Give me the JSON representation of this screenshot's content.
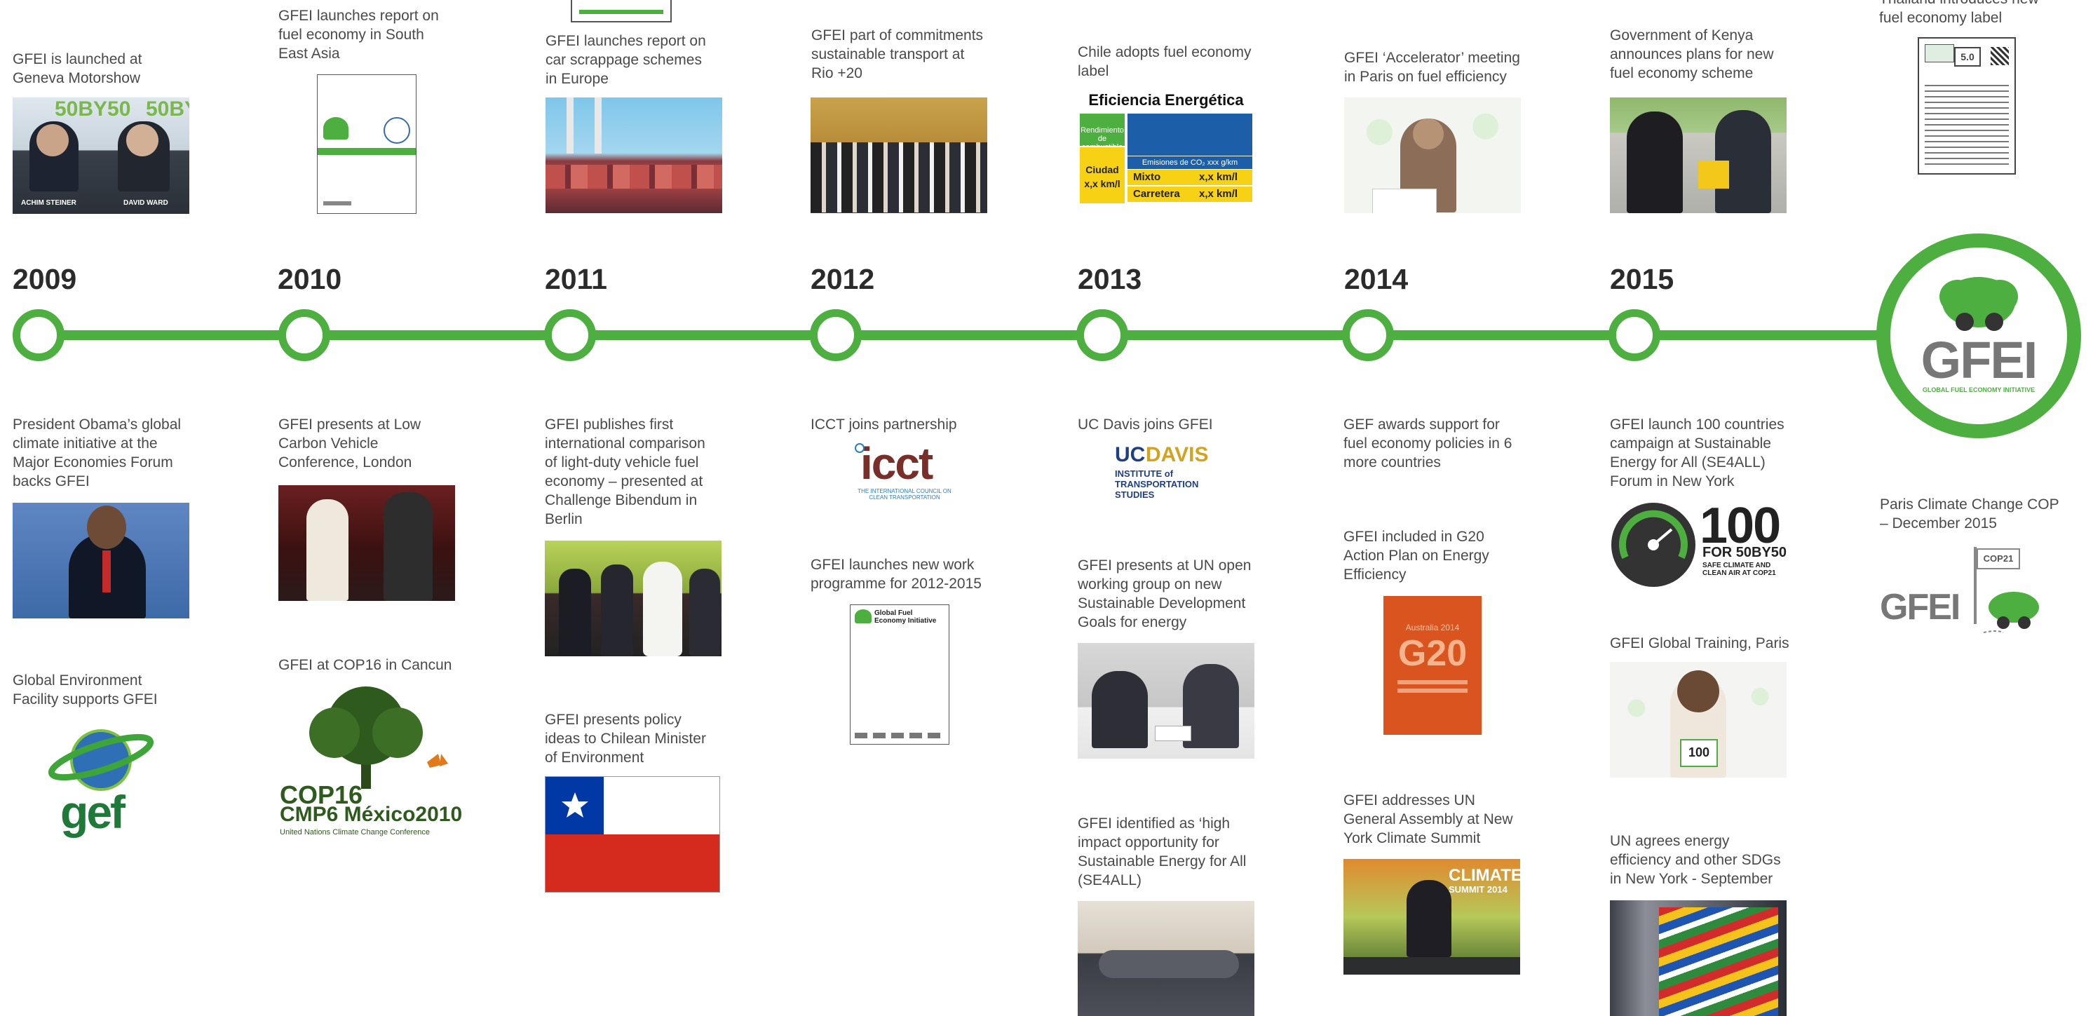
{
  "years": [
    "2009",
    "2010",
    "2011",
    "2012",
    "2013",
    "2014",
    "2015"
  ],
  "top_items": {
    "t2009": "GFEI is launched at Geneva Motorshow",
    "t2010": "GFEI launches report on fuel economy in South East Asia",
    "t2011": "GFEI launches report on car scrappage schemes in Europe",
    "t2012": "GFEI part of commitments sustainable transport at Rio +20",
    "t2013": "Chile adopts fuel economy label",
    "t2014": "GFEI ‘Accelerator’ meeting in Paris on fuel efficiency",
    "t2015": "Government of Kenya announces plans for new fuel economy scheme",
    "t2016": "Thailand introduces new fuel economy label"
  },
  "bottom_items": {
    "b2009a": "President Obama’s global climate initiative at the Major Economies Forum backs GFEI",
    "b2009b": "Global Environment Facility supports GFEI",
    "b2010a": "GFEI presents at Low Carbon Vehicle Conference, London",
    "b2010b": "GFEI at COP16 in Cancun",
    "b2011a": "GFEI publishes first international comparison of light-duty vehicle fuel economy – presented at Challenge Bibendum in Berlin",
    "b2011b": "GFEI presents policy ideas to Chilean Minister of Environment",
    "b2012a": "ICCT joins partnership",
    "b2012b": "GFEI launches new work programme for 2012-2015",
    "b2013a": "UC Davis joins GFEI",
    "b2013b": "GFEI presents at UN open working group on new Sustainable Development Goals for energy",
    "b2013c": "GFEI identified as ‘high impact opportunity for Sustainable Energy for All (SE4ALL)",
    "b2014a": "GEF awards support for fuel economy policies in 6 more countries",
    "b2014b": "GFEI included in G20 Action Plan on Energy Efficiency",
    "b2014c": "GFEI addresses UN General Assembly at New York Climate Summit",
    "b2015a": "GFEI launch 100 countries campaign at Sustainable Energy for All (SE4ALL) Forum in New York",
    "b2015b": "GFEI Global Training, Paris",
    "b2015c": "UN agrees energy efficiency and other SDGs in New York - September",
    "b2016": "Paris Climate Change COP – December 2015"
  },
  "image_text": {
    "motorshow_banner": "50BY50",
    "name_left": "ACHIM STEINER",
    "name_right": "DAVID WARD",
    "label_title": "Eficiencia Energética",
    "label_rendimiento": "Rendimiento de combustible",
    "label_ciudad": "Ciudad",
    "label_ciudad_val": "x,x km/l",
    "label_mixto": "Mixto",
    "label_mixto_val": "x,x km/l",
    "label_carretera": "Carretera",
    "label_carretera_val": "x,x km/l",
    "label_emisiones": "Emisiones de CO₂ xxx g/km",
    "icct_logo": "icct",
    "icct_sub": "THE INTERNATIONAL COUNCIL ON CLEAN TRANSPORTATION",
    "ucdavis_uc": "UC",
    "ucdavis_davis": "DAVIS",
    "ucdavis_sub": "INSTITUTE of TRANSPORTATION STUDIES",
    "gef_logo": "gef",
    "cop16_line1": "COP16",
    "cop16_line2": "CMP6 México2010",
    "cop16_sub": "United Nations Climate Change Conference",
    "workprog_title": "Global Fuel Economy Initiative",
    "g20_text": "G20",
    "g20_year": "Australia 2014",
    "climate_summit": "CLIMATE",
    "climate_summit2": "SUMMIT 2014",
    "hundred": "100",
    "hundred_sub": "FOR 50BY50",
    "hundred_sub2": "SAFE CLIMATE AND CLEAN AIR AT COP21",
    "training_banner": "100",
    "gfei_brand": "GFEI",
    "gfei_brand_sub": "GLOBAL FUEL ECONOMY INITIATIVE",
    "cop21_flag": "COP21",
    "thai_value": "5.0"
  },
  "colors": {
    "brand_green": "#4caf3f",
    "gef_green": "#1f7a3a",
    "label_blue": "#1c5fa8",
    "label_yellow": "#f7d114",
    "chile_red": "#d52b1e",
    "chile_blue": "#0039a6",
    "g20_orange": "#d9541e"
  }
}
